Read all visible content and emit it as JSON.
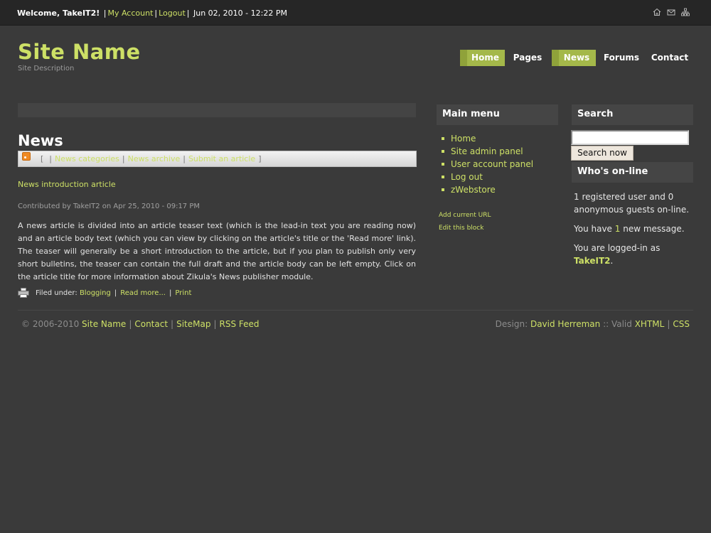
{
  "topbar": {
    "welcome": "Welcome, TakeIT2!",
    "my_account": "My Account",
    "logout": "Logout",
    "datetime": "Jun 02, 2010 - 12:22 PM",
    "icons": [
      "home-icon",
      "mail-icon",
      "sitemap-icon"
    ]
  },
  "header": {
    "site_name": "Site Name",
    "site_description": "Site Description"
  },
  "nav": {
    "items": [
      {
        "label": "Home",
        "active": true
      },
      {
        "label": "Pages",
        "active": false
      },
      {
        "label": "News",
        "active": true
      },
      {
        "label": "Forums",
        "active": false
      },
      {
        "label": "Contact",
        "active": false
      }
    ]
  },
  "content": {
    "page_title": "News",
    "subnav": {
      "news_categories": "News categories",
      "news_archive": "News archive",
      "submit_article": "Submit an article"
    },
    "article": {
      "title": "News introduction article",
      "contributed": "Contributed by TakeIT2 on Apr 25, 2010 - 09:17 PM",
      "body": "A news article is divided into an article teaser text (which is the lead-in text you are reading now) and an article body text (which you can view by clicking on the article's title or the 'Read more' link). The teaser will generally be a short introduction to the article, but if you plan to publish only very short bulletins, the teaser can contain the full draft and the article body can be left empty. Click on the article title for more information about Zikula's News publisher module.",
      "filed_under_label": "Filed under:",
      "category": "Blogging",
      "read_more": "Read more...",
      "print": "Print"
    }
  },
  "main_menu": {
    "title": "Main menu",
    "items": [
      "Home",
      "Site admin panel",
      "User account panel",
      "Log out",
      "zWebstore"
    ],
    "add_current_url": "Add current URL",
    "edit_block": "Edit this block"
  },
  "search": {
    "title": "Search",
    "input_value": "",
    "button_label": "Search now"
  },
  "whos_online": {
    "title": "Who's on-line",
    "line1": "1 registered user and 0 anonymous guests on-line.",
    "line2_pre": "You have ",
    "line2_count": "1",
    "line2_post": " new message.",
    "line3_pre": "You are logged-in as ",
    "line3_user": "TakeIT2",
    "line3_post": "."
  },
  "footer": {
    "copyright_symbol": "©",
    "years": " 2006-2010 ",
    "site_name": "Site Name",
    "contact": "Contact",
    "sitemap": "SiteMap",
    "rss": "RSS Feed",
    "design_label": "Design: ",
    "designer": "David Herreman",
    "valid_label": " :: Valid ",
    "xhtml": "XHTML",
    "css": "CSS"
  },
  "colors": {
    "accent": "#cde066",
    "background": "#3a3a3a",
    "topbar": "#262626",
    "nav_active": "#a4b84a"
  }
}
